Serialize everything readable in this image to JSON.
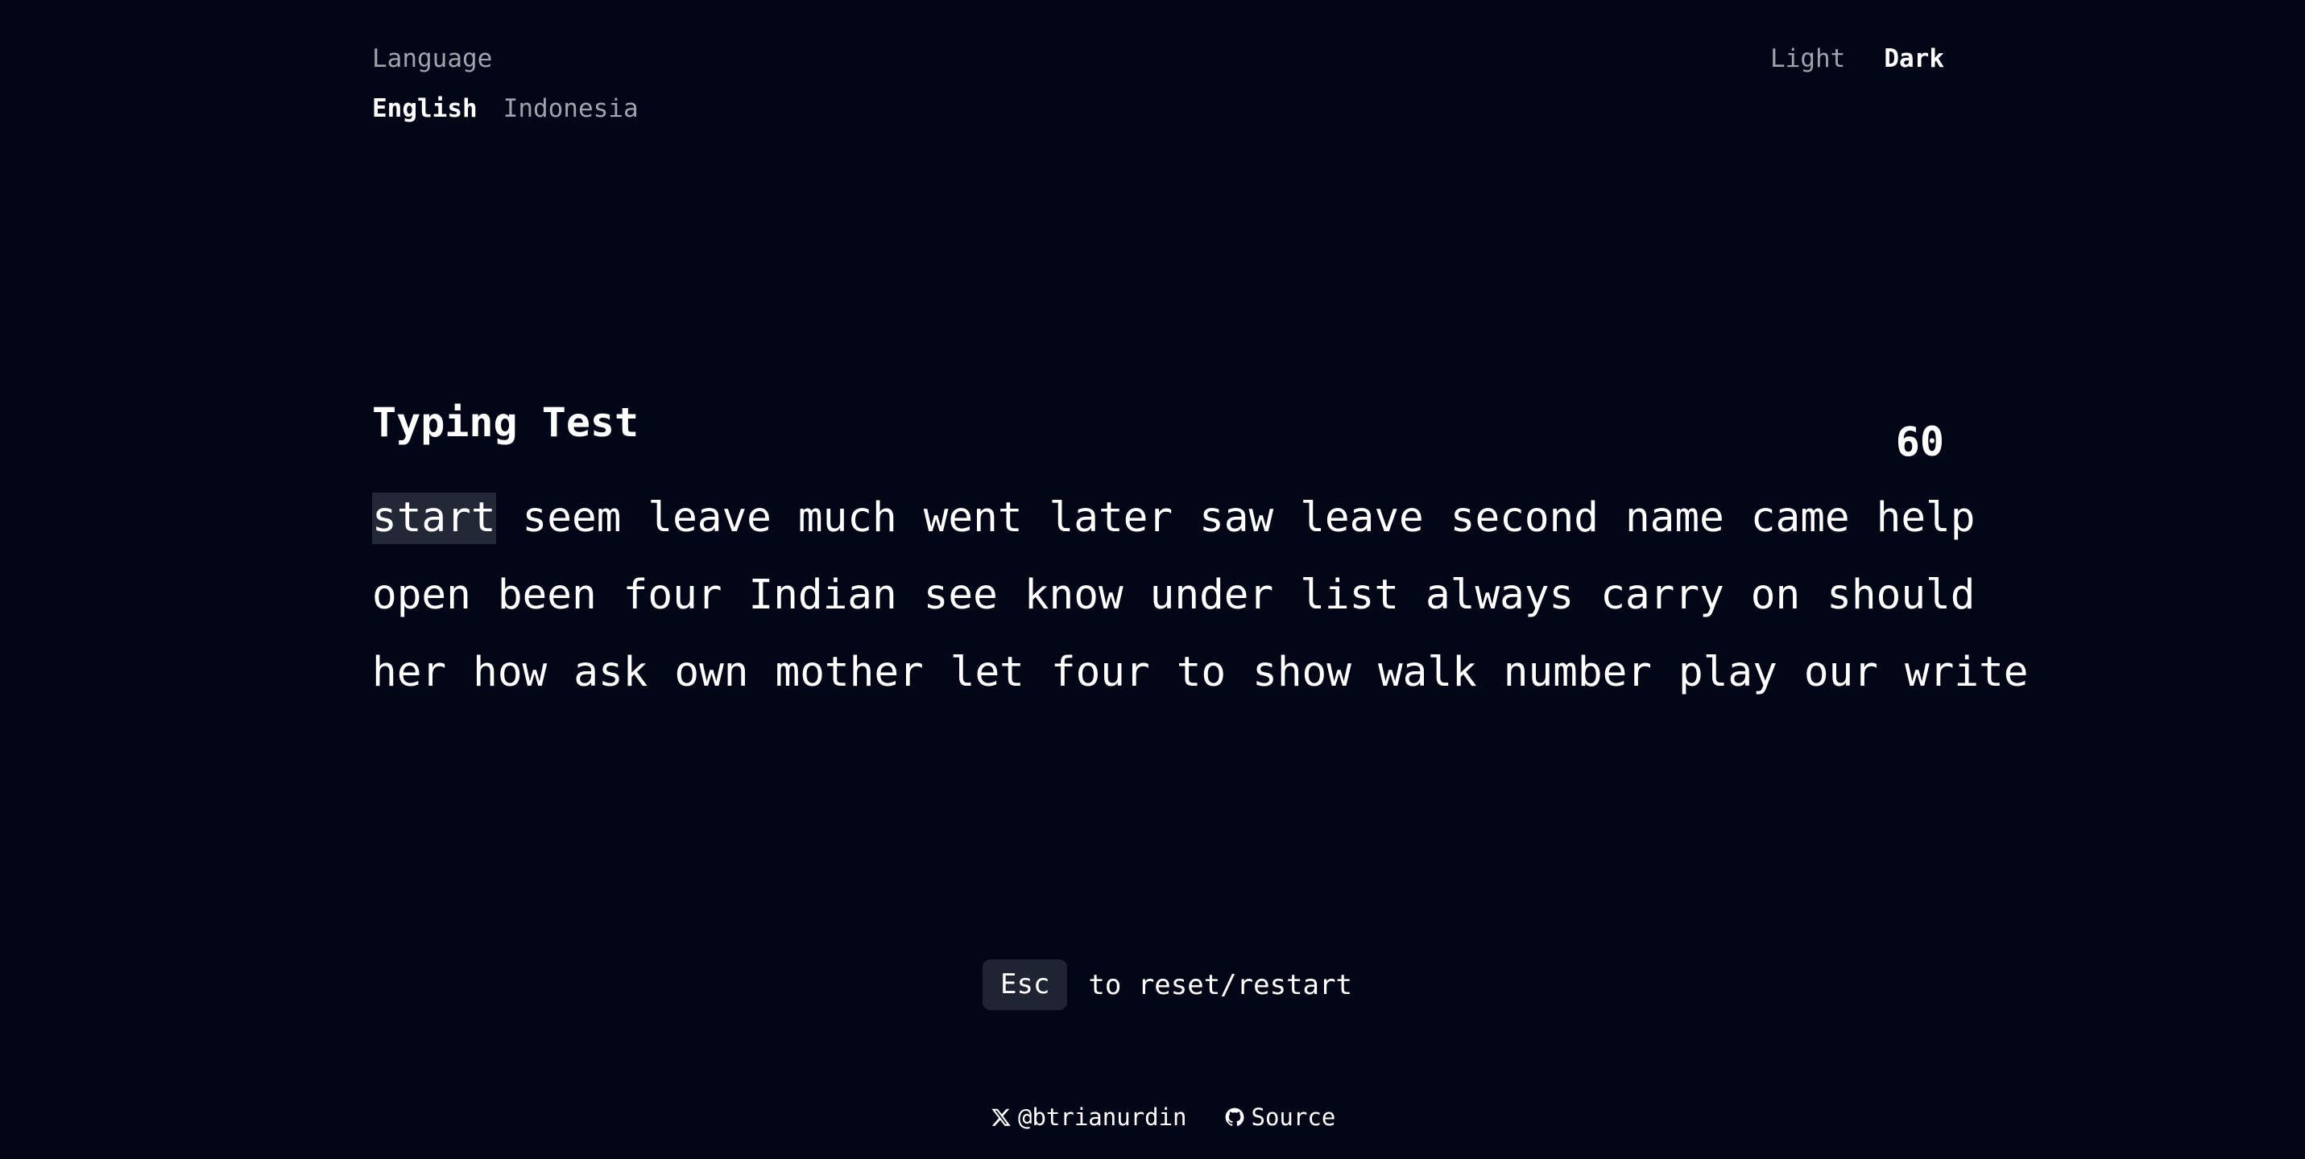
{
  "language": {
    "label": "Language",
    "options": [
      "English",
      "Indonesia"
    ],
    "selected": "English"
  },
  "theme": {
    "options": [
      "Light",
      "Dark"
    ],
    "selected": "Dark"
  },
  "test": {
    "title": "Typing Test",
    "timer": "60",
    "current_word": "start",
    "lines": [
      [
        "start",
        "seem",
        "leave",
        "much",
        "went",
        "later",
        "saw",
        "leave",
        "second",
        "name",
        "came",
        "help"
      ],
      [
        "open",
        "been",
        "four",
        "Indian",
        "see",
        "know",
        "under",
        "list",
        "always",
        "carry",
        "on",
        "should"
      ],
      [
        "her",
        "how",
        "ask",
        "own",
        "mother",
        "let",
        "four",
        "to",
        "show",
        "walk",
        "number",
        "play",
        "our",
        "write"
      ]
    ]
  },
  "hint": {
    "key": "Esc",
    "text": "to reset/restart"
  },
  "footer": {
    "twitter_label": "@btrianurdin",
    "twitter_icon": "x-logo-icon",
    "source_label": "Source",
    "source_icon": "github-icon"
  },
  "colors": {
    "background": "#030616",
    "text": "#ffffff",
    "muted": "#a0a3ad",
    "highlight": "#232836",
    "key_bg": "#1f2432"
  }
}
